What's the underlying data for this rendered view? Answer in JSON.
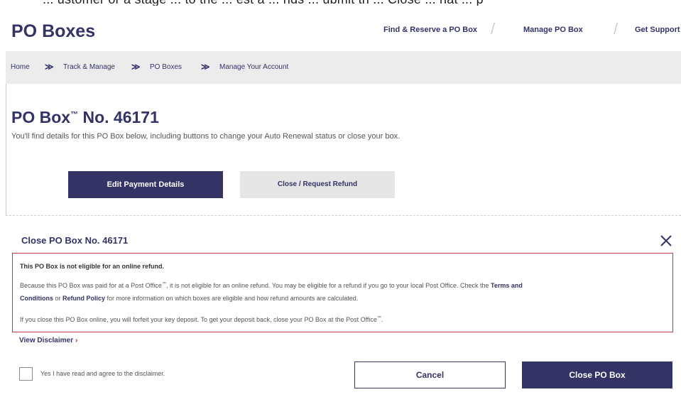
{
  "top_partial_text": "... ustomer or a stage ... to the ... est a ... nds ... ubmit th ... Close ... hat ... p",
  "header": {
    "title": "PO Boxes",
    "nav": [
      "Find & Reserve a PO Box",
      "Manage PO Box",
      "Get Support"
    ],
    "separator": "/"
  },
  "breadcrumb": {
    "items": [
      "Home",
      "Track & Manage",
      "PO Boxes",
      "Manage Your Account"
    ],
    "separator": "≫"
  },
  "page": {
    "title_prefix": "PO Box",
    "title_tm": "™",
    "title_suffix": " No. 46171",
    "intro": "You'll find details for this PO Box below, including buttons to change your Auto Renewal status or close your box."
  },
  "actions": {
    "edit_payment": "Edit Payment Details",
    "close_request_refund": "Close / Request Refund"
  },
  "modal": {
    "title": "Close PO Box No. 46171",
    "close_icon": "close-icon",
    "notice_heading": "This PO Box is not eligible for an online refund.",
    "p1_a": "Because this PO Box was paid for at a Post Office",
    "p1_tm": "™",
    "p1_b": ", it is not eligible for an online refund. You may be eligible for a refund if you go to your local Post Office. Check the ",
    "p1_link1a": "Terms and",
    "p1_link1b": "Conditions",
    "p1_c": " or ",
    "p1_link2": "Refund Policy",
    "p1_d": " for more information on which boxes are eligible and how refund amounts are calculated.",
    "p2_a": "If you close this PO Box online, you will forfeit your key deposit. To get your deposit back, close your PO Box at the Post Office",
    "p2_tm": "™",
    "p2_b": ".",
    "view_disclaimer": "View Disclaimer",
    "view_disclaimer_chevron": "›",
    "checkbox_label": "Yes I have read and agree to the disclaimer.",
    "cancel_label": "Cancel",
    "close_box_label": "Close PO Box"
  },
  "colors": {
    "brand_navy": "#333366",
    "alert_red": "#c33a3a",
    "usps_red": "#e71921",
    "breadcrumb_bg": "#ececec"
  }
}
